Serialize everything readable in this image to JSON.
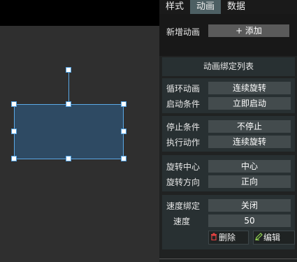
{
  "tabs": [
    {
      "label": "样式",
      "active": false
    },
    {
      "label": "动画",
      "active": true
    },
    {
      "label": "数据",
      "active": false
    }
  ],
  "add": {
    "label": "新增动画",
    "button": "+ 添加"
  },
  "list_title": "动画绑定列表",
  "groups": [
    [
      {
        "label": "循环动画",
        "value": "连续旋转"
      },
      {
        "label": "启动条件",
        "value": "立即启动"
      }
    ],
    [
      {
        "label": "停止条件",
        "value": "不停止"
      },
      {
        "label": "执行动作",
        "value": "连续旋转"
      }
    ],
    [
      {
        "label": "旋转中心",
        "value": "中心"
      },
      {
        "label": "旋转方向",
        "value": "正向"
      }
    ],
    [
      {
        "label": "速度绑定",
        "value": "关闭"
      },
      {
        "label": "速度",
        "value": "50"
      }
    ]
  ],
  "actions": {
    "delete": "删除",
    "edit": "编辑"
  },
  "colors": {
    "accent": "#4f9fe0",
    "shape_fill": "#2e4a63",
    "delete_icon": "#e04040",
    "edit_icon": "#8fd14f"
  }
}
